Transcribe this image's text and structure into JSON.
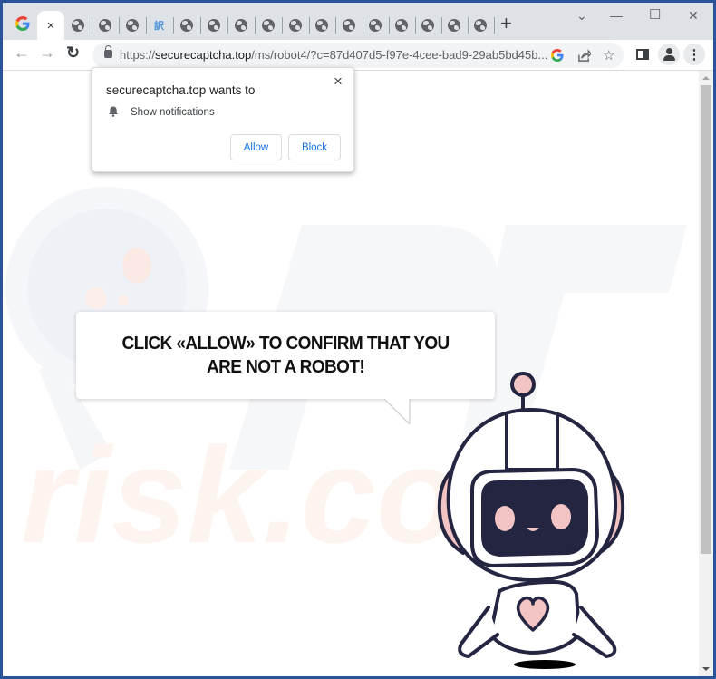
{
  "browser": {
    "tabs": [
      {
        "icon": "google-icon",
        "label": "G"
      },
      {
        "icon": "close-icon",
        "label": "×",
        "active": true
      },
      {
        "icon": "globe-icon"
      },
      {
        "icon": "globe-icon"
      },
      {
        "icon": "globe-icon"
      },
      {
        "icon": "translate-icon"
      },
      {
        "icon": "globe-icon"
      },
      {
        "icon": "globe-icon"
      },
      {
        "icon": "globe-icon"
      },
      {
        "icon": "globe-icon"
      },
      {
        "icon": "globe-icon"
      },
      {
        "icon": "globe-icon"
      },
      {
        "icon": "globe-icon"
      },
      {
        "icon": "globe-icon"
      },
      {
        "icon": "globe-icon"
      },
      {
        "icon": "globe-icon"
      },
      {
        "icon": "globe-icon"
      },
      {
        "icon": "globe-icon"
      }
    ],
    "new_tab_label": "+",
    "window_controls": {
      "tab_search": "⌄",
      "minimize": "—",
      "maximize": "☐",
      "close": "✕"
    },
    "nav": {
      "back": "←",
      "forward": "→",
      "reload": "↻"
    },
    "url_domain": "securecaptcha.top",
    "url_prefix": "https://",
    "url_rest": "/ms/robot4/?c=87d407d5-f97e-4cee-bad9-29ab5bd45b...",
    "omnibox_icons": {
      "google": "G",
      "share": "⇪",
      "bookmark": "☆"
    },
    "menu_label": "⋮"
  },
  "notification_popup": {
    "title": "securecaptcha.top wants to",
    "permission": "Show notifications",
    "close_label": "×",
    "allow_label": "Allow",
    "block_label": "Block"
  },
  "page": {
    "message_line1": "CLICK «ALLOW» TO CONFIRM THAT YOU",
    "message_line2": "ARE NOT A ROBOT!",
    "watermark_text": "risk.com"
  },
  "colors": {
    "accent": "#1a73e8",
    "robot_outline": "#232541",
    "robot_pink": "#f2c4c4",
    "window_frame": "#2a5499"
  }
}
